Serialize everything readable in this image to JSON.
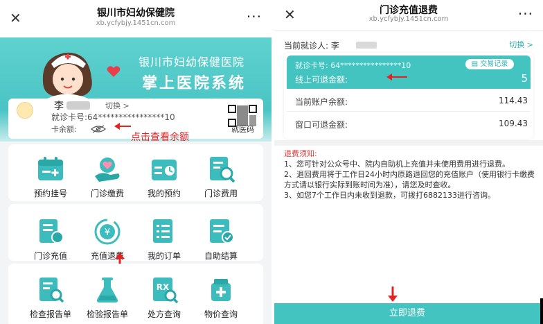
{
  "left": {
    "nav": {
      "title": "银川市妇幼保健院",
      "url": "xb.ycfybjy.1451cn.com",
      "close": "✕",
      "more": "···"
    },
    "banner": {
      "line1": "银川市妇幼保健医院",
      "line2": "掌上医院系统"
    },
    "card": {
      "name": "李",
      "switch": "切换 >",
      "card_no": "就诊卡号:64****************10",
      "balance_label": "卡余额:",
      "tip": "点击查看余额",
      "qr_label": "就医码"
    },
    "grid1": [
      "预约挂号",
      "门诊缴费",
      "我的预约",
      "门诊费用"
    ],
    "grid2": [
      "门诊充值",
      "充值退费",
      "我的订单",
      "自助结算"
    ],
    "grid3": [
      "检查报告单",
      "检验报告单",
      "处方查询",
      "物价查询"
    ]
  },
  "right": {
    "nav": {
      "title": "门诊充值退费",
      "url": "xb.ycfybjy.1451cn.com",
      "close": "✕",
      "more": "···"
    },
    "patient": "当前就诊人: 李",
    "switch": "切换 >",
    "card_no": "就诊卡号: 64****************10",
    "tx_button": "交易记录",
    "refund_label": "线上可退金额:",
    "refund_value": "5",
    "balance_label": "当前账户余额:",
    "balance_value": "114.43",
    "window_label": "窗口可退金额:",
    "window_value": "109.43",
    "notice_title": "退费须知:",
    "notice_lines": [
      "1、您可针对公众号中、院内自助机上充值并未使用费用进行退费。",
      "2、退回费用将于工作日24小时内原路退回您的充值账户（使用银行卡缴费方式请以银行实际到账时间为准），请您及时查收。",
      "3、如您7个工作日内未收到退款，可拨打6882133进行咨询。"
    ],
    "refund_button": "立即退费"
  },
  "colors": {
    "teal": "#44c4c1",
    "red": "#e32222",
    "nav_bg": "#ffffff"
  }
}
